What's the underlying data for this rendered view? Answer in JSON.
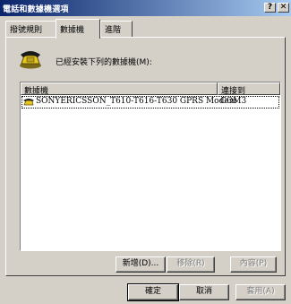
{
  "window": {
    "title": "電話和數據機選項",
    "help_button": "?",
    "close_button": "✕"
  },
  "tabs": [
    {
      "label": "撥號規則",
      "selected": false
    },
    {
      "label": "數據機",
      "selected": true
    },
    {
      "label": "進階",
      "selected": false
    }
  ],
  "main": {
    "description": "已經安裝下列的數據機(M):",
    "icon": "phone-icon"
  },
  "list": {
    "columns": [
      "數據機",
      "連接到"
    ],
    "rows": [
      {
        "name": "SONYERICSSON_T610-T616-T630 GPRS Modem",
        "port": "COM3",
        "icon": "modem-icon"
      }
    ]
  },
  "buttons": {
    "add": "新增(D)...",
    "remove": "移除(R)",
    "properties": "內容(P)",
    "ok": "確定",
    "cancel": "取消",
    "apply": "套用(A)"
  }
}
